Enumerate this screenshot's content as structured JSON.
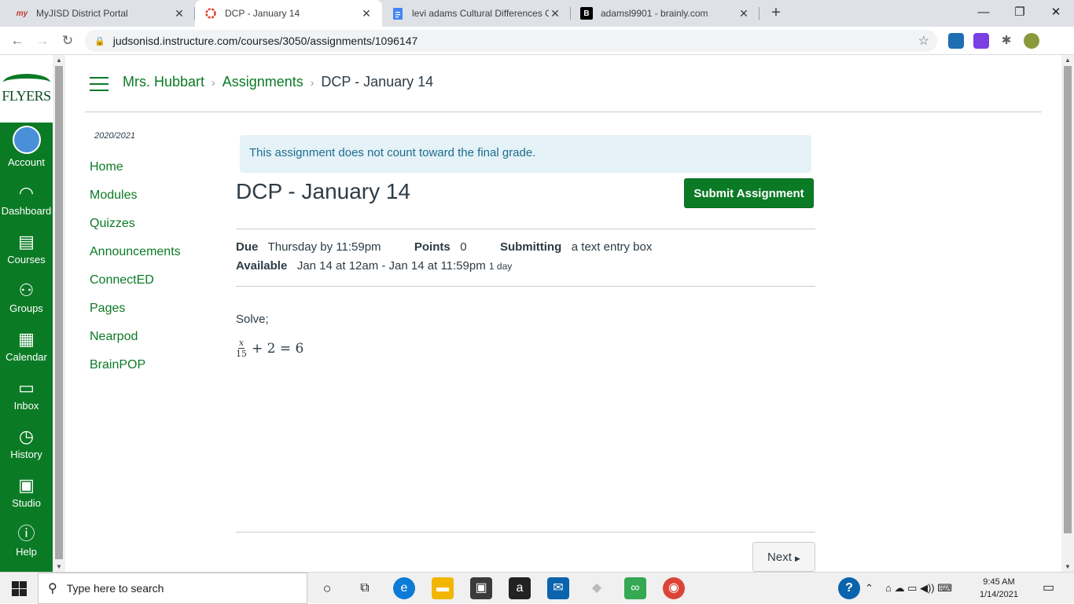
{
  "browser": {
    "tabs": [
      {
        "title": "MyJISD District Portal",
        "favicon": "my"
      },
      {
        "title": "DCP - January 14",
        "favicon": "canvas-icon"
      },
      {
        "title": "levi adams Cultural Differences C",
        "favicon": "docs-icon"
      },
      {
        "title": "adamsl9901 - brainly.com",
        "favicon": "B"
      }
    ],
    "url": "judsonisd.instructure.com/courses/3050/assignments/1096147"
  },
  "global_nav": {
    "logo_text": "FLYERS",
    "items": [
      "Account",
      "Dashboard",
      "Courses",
      "Groups",
      "Calendar",
      "Inbox",
      "History",
      "Studio",
      "Help"
    ]
  },
  "breadcrumb": {
    "course": "Mrs. Hubbart",
    "section": "Assignments",
    "current": "DCP - January 14"
  },
  "course_nav": {
    "term": "2020/2021",
    "items": [
      "Home",
      "Modules",
      "Quizzes",
      "Announcements",
      "ConnectED",
      "Pages",
      "Nearpod",
      "BrainPOP"
    ]
  },
  "assignment": {
    "alert": "This assignment does not count toward the final grade.",
    "title": "DCP - January 14",
    "submit_label": "Submit Assignment",
    "due_label": "Due",
    "due_value": "Thursday by 11:59pm",
    "points_label": "Points",
    "points_value": "0",
    "submitting_label": "Submitting",
    "submitting_value": "a text entry box",
    "available_label": "Available",
    "available_value": "Jan 14 at 12am - Jan 14 at 11:59pm",
    "available_duration": "1 day",
    "body_text": "Solve;",
    "equation": {
      "numerator": "x",
      "denominator": "15",
      "rest": "+ 2 = 6"
    },
    "next_label": "Next"
  },
  "taskbar": {
    "search_placeholder": "Type here to search",
    "time": "9:45 AM",
    "date": "1/14/2021"
  },
  "colors": {
    "brand": "#0b7a25",
    "alert_bg": "#e5f2f8",
    "alert_text": "#1e6c8c"
  }
}
